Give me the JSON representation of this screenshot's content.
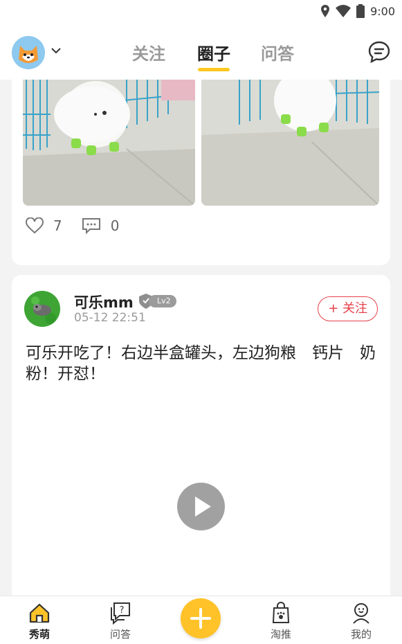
{
  "status_bar": {
    "time": "9:00",
    "icons": [
      "location-icon",
      "wifi-icon",
      "battery-icon"
    ]
  },
  "top_nav": {
    "tabs": [
      {
        "label": "关注",
        "active": false
      },
      {
        "label": "圈子",
        "active": true
      },
      {
        "label": "问答",
        "active": false
      }
    ],
    "accent_color": "#ffc81e"
  },
  "feed": {
    "prev_post": {
      "likes": "7",
      "comments": "0"
    },
    "post": {
      "username": "可乐mm",
      "level": "Lv2",
      "timestamp": "05-12 22:51",
      "follow_label": "+ 关注",
      "text": "可乐开吃了！右边半盒罐头，左边狗粮　钙片　奶粉！开怼！"
    }
  },
  "bottom_nav": {
    "items": [
      {
        "label": "秀萌",
        "icon": "home-icon",
        "active": true
      },
      {
        "label": "问答",
        "icon": "question-bubble-icon",
        "active": false
      },
      {
        "label": "淘推",
        "icon": "shopping-bag-icon",
        "active": false
      },
      {
        "label": "我的",
        "icon": "profile-icon",
        "active": false
      }
    ],
    "fab_color": "#ffc329"
  }
}
